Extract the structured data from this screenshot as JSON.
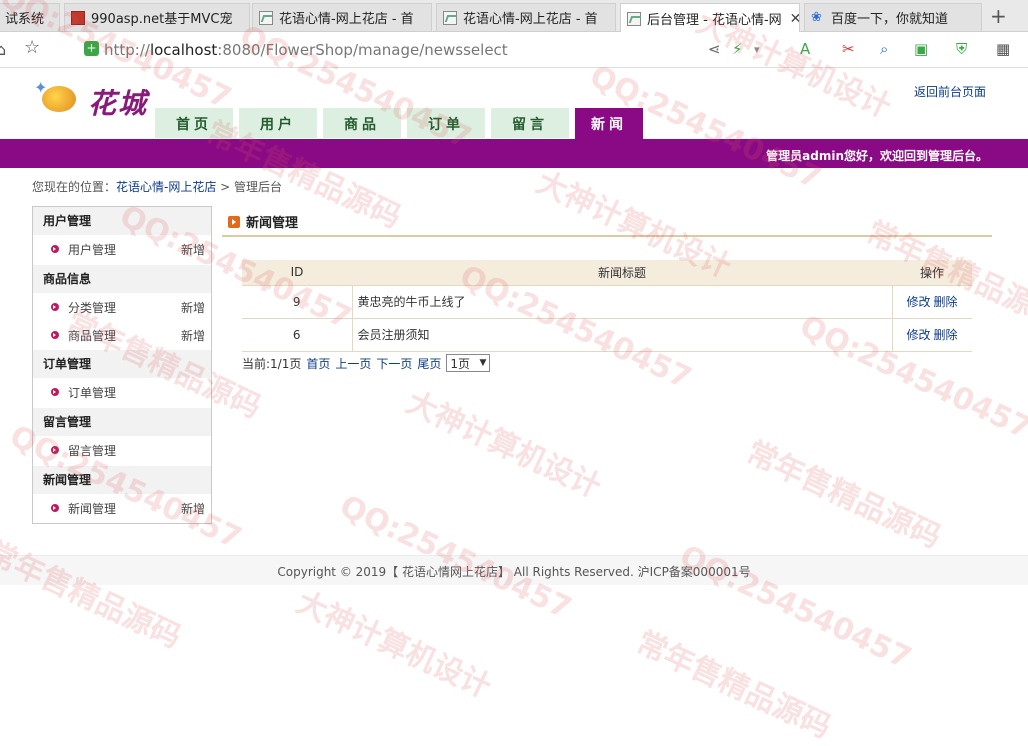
{
  "browser": {
    "tabs": [
      {
        "label": "试系统"
      },
      {
        "label": "990asp.net基于MVC宠"
      },
      {
        "label": "花语心情-网上花店 - 首"
      },
      {
        "label": "花语心情-网上花店 - 首"
      },
      {
        "label": "后台管理 - 花语心情-网"
      },
      {
        "label": "百度一下，你就知道"
      }
    ],
    "url_host": "localhost",
    "url_prefix": "http://",
    "url_rest": ":8080/FlowerShop/manage/newsselect"
  },
  "site": {
    "logo_text": "花城",
    "back_link": "返回前台页面",
    "nav": [
      "首页",
      "用户",
      "商品",
      "订单",
      "留言",
      "新闻"
    ],
    "welcome": "管理员admin您好，欢迎回到管理后台。",
    "crumb_prefix": "您现在的位置：",
    "crumb_link": "花语心情-网上花店",
    "crumb_sep": " > ",
    "crumb_current": "管理后台"
  },
  "sidebar": {
    "groups": [
      {
        "title": "用户管理",
        "items": [
          {
            "label": "用户管理",
            "add": "新增"
          }
        ]
      },
      {
        "title": "商品信息",
        "items": [
          {
            "label": "分类管理",
            "add": "新增"
          },
          {
            "label": "商品管理",
            "add": "新增"
          }
        ]
      },
      {
        "title": "订单管理",
        "items": [
          {
            "label": "订单管理",
            "add": ""
          }
        ]
      },
      {
        "title": "留言管理",
        "items": [
          {
            "label": "留言管理",
            "add": ""
          }
        ]
      },
      {
        "title": "新闻管理",
        "items": [
          {
            "label": "新闻管理",
            "add": "新增"
          }
        ]
      }
    ]
  },
  "main": {
    "title": "新闻管理",
    "table": {
      "headers": [
        "ID",
        "新闻标题",
        "操作"
      ],
      "rows": [
        {
          "id": "9",
          "title": "黄忠亮的牛币上线了",
          "edit": "修改",
          "delete": "删除"
        },
        {
          "id": "6",
          "title": "会员注册须知",
          "edit": "修改",
          "delete": "删除"
        }
      ]
    },
    "pager": {
      "info": "当前:1/1页",
      "first": "首页",
      "prev": "上一页",
      "next": "下一页",
      "last": "尾页",
      "select_value": "1页"
    }
  },
  "footer": {
    "text": "Copyright © 2019【 花语心情网上花店】 All Rights Reserved. 沪ICP备案000001号"
  },
  "watermarks": [
    "QQ:254540457",
    "大神计算机设计",
    "常年售精品源码"
  ]
}
